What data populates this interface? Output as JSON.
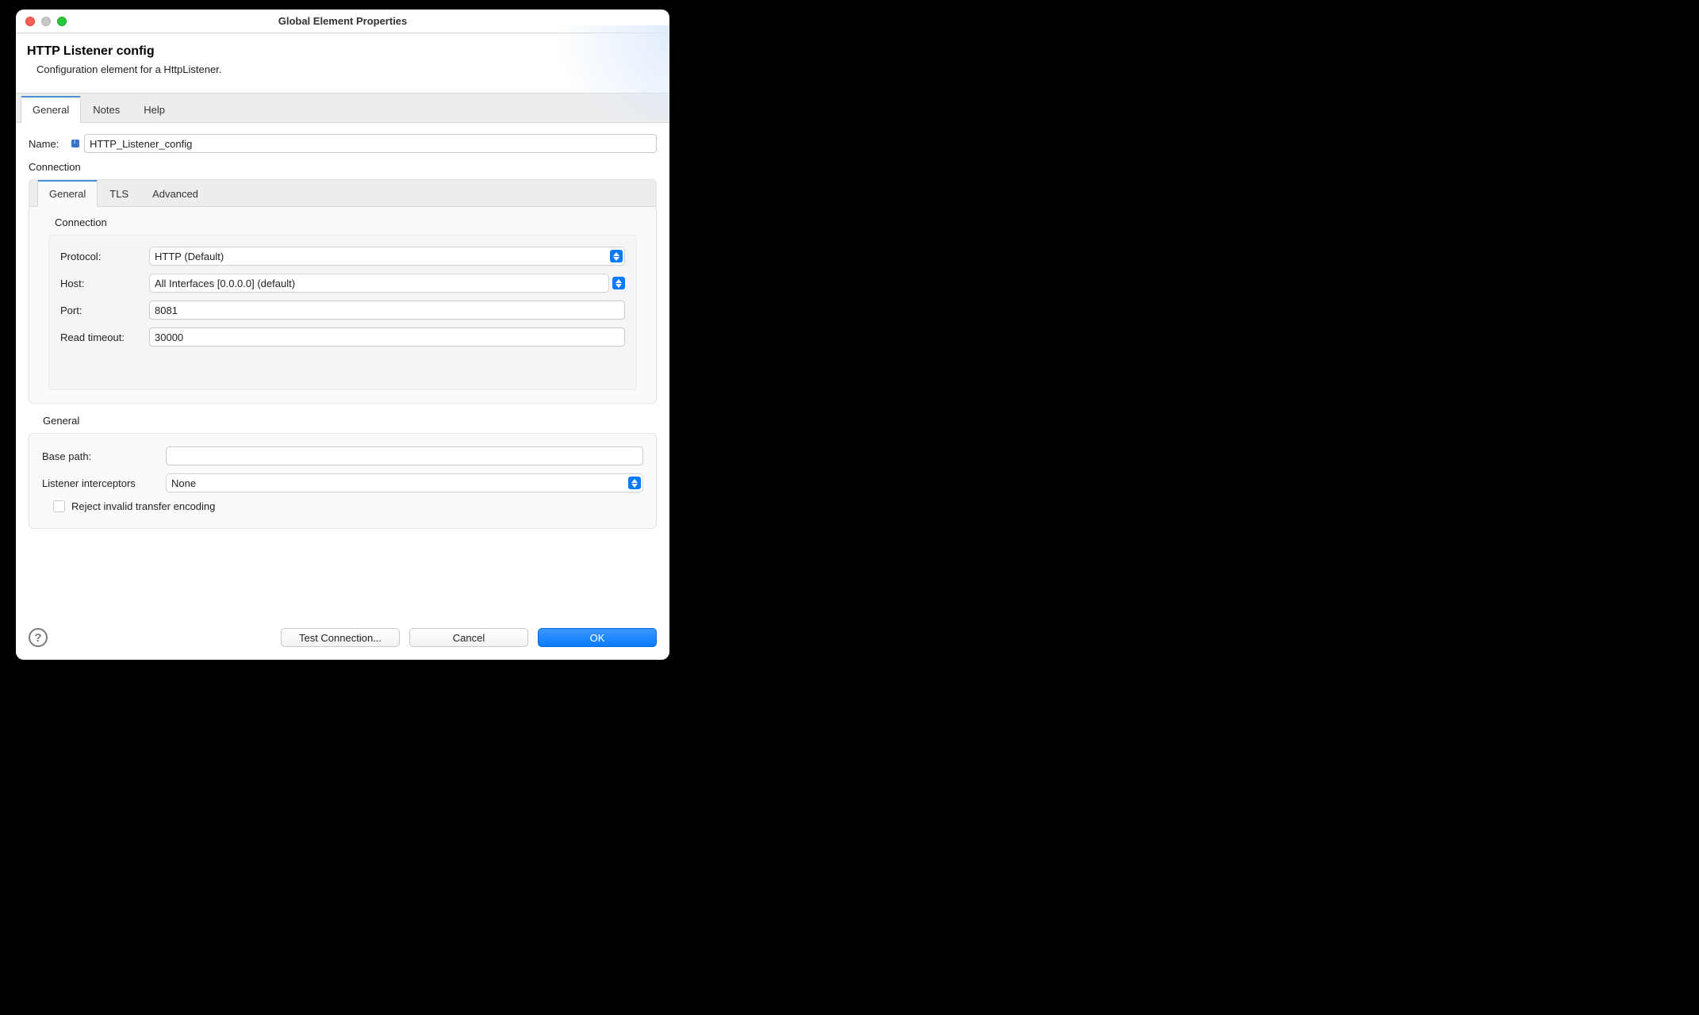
{
  "window": {
    "title": "Global Element Properties"
  },
  "header": {
    "title": "HTTP Listener config",
    "description": "Configuration element for a HttpListener."
  },
  "mainTabs": {
    "t0": "General",
    "t1": "Notes",
    "t2": "Help"
  },
  "name": {
    "label": "Name:",
    "value": "HTTP_Listener_config"
  },
  "connection": {
    "label": "Connection",
    "innerTabs": {
      "t0": "General",
      "t1": "TLS",
      "t2": "Advanced"
    },
    "subLabel": "Connection",
    "fields": {
      "protocol": {
        "label": "Protocol:",
        "value": "HTTP (Default)"
      },
      "host": {
        "label": "Host:",
        "value": "All Interfaces [0.0.0.0] (default)"
      },
      "port": {
        "label": "Port:",
        "value": "8081"
      },
      "readTimeout": {
        "label": "Read timeout:",
        "value": "30000"
      }
    }
  },
  "general": {
    "label": "General",
    "basePath": {
      "label": "Base path:",
      "value": ""
    },
    "interceptors": {
      "label": "Listener interceptors",
      "value": "None"
    },
    "rejectInvalid": {
      "label": "Reject invalid transfer encoding",
      "checked": false
    }
  },
  "footer": {
    "test": "Test Connection...",
    "cancel": "Cancel",
    "ok": "OK"
  }
}
